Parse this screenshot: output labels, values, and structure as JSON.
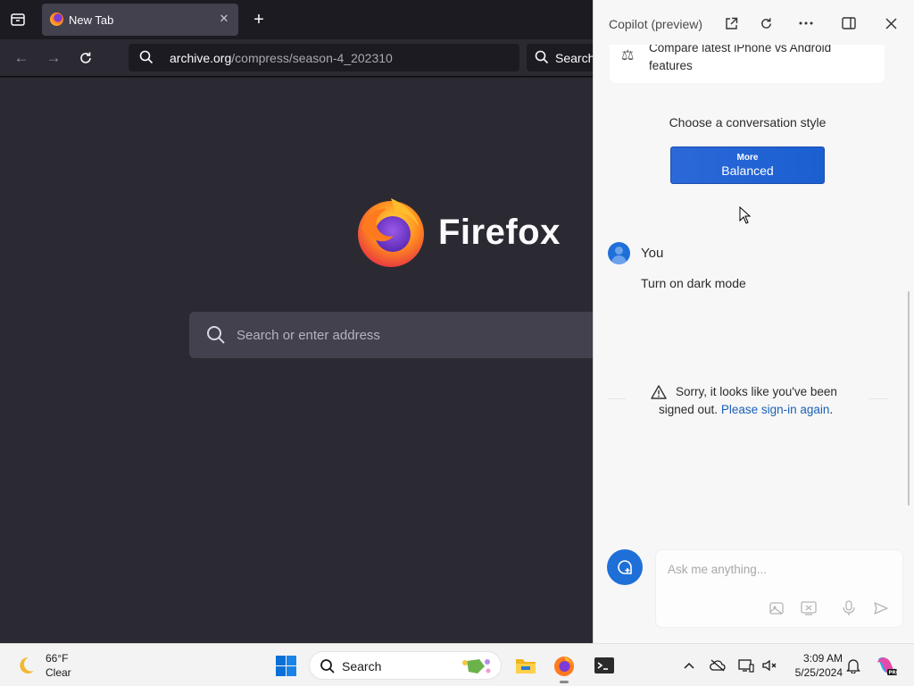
{
  "firefox": {
    "tab_title": "New Tab",
    "url_host": "archive.org",
    "url_path": "/compress/season-4_202310",
    "search_label": "Search",
    "wordmark": "Firefox",
    "search_placeholder": "Search or enter address"
  },
  "copilot": {
    "title": "Copilot (preview)",
    "suggestion_card": "Compare latest iPhone vs Android features",
    "style_prompt": "Choose a conversation style",
    "style_button_small": "More",
    "style_button_big": "Balanced",
    "user_name": "You",
    "user_message": "Turn on dark mode",
    "warning_text": "Sorry, it looks like you've been",
    "warning_text2": "signed out.",
    "warning_link": "Please sign-in again",
    "warning_end": ".",
    "input_placeholder": "Ask me anything..."
  },
  "taskbar": {
    "weather_temp": "66°F",
    "weather_condition": "Clear",
    "search_label": "Search",
    "time": "3:09 AM",
    "date": "5/25/2024"
  },
  "colors": {
    "accent": "#1f6fd8",
    "firefox_bg": "#2b2a33",
    "link": "#1b5fb8"
  }
}
